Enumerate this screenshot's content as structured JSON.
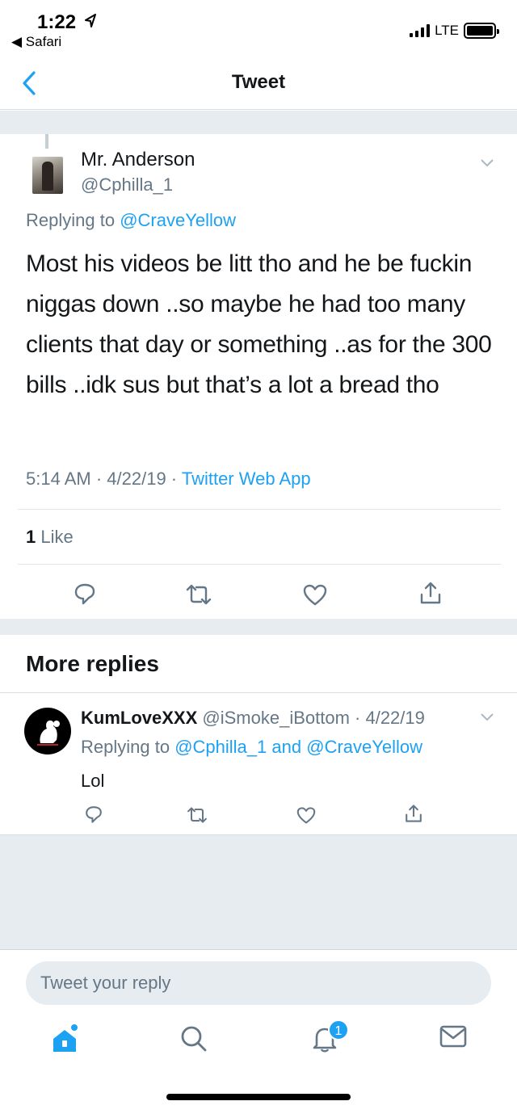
{
  "status_bar": {
    "time": "1:22",
    "back_app": "◀ Safari",
    "network": "LTE",
    "signal_bars": 4,
    "battery_level": 0.85
  },
  "nav": {
    "title": "Tweet",
    "back_icon": "chevron-left-icon"
  },
  "tweet": {
    "author_name": "Mr. Anderson",
    "author_handle": "@Cphilla_1",
    "replying_prefix": "Replying to",
    "replying_to": "@CraveYellow",
    "text": "Most his videos be litt tho and he be fuckin niggas down ..so maybe he had too many clients that day or something ..as for the 300 bills ..idk sus but that’s a lot a bread tho",
    "time": "5:14 AM",
    "date": "4/22/19",
    "source": "Twitter Web App",
    "like_count": "1",
    "like_label": "Like"
  },
  "more_replies": {
    "title": "More replies",
    "items": [
      {
        "name": "KumLoveXXX",
        "handle": "@iSmoke_iBottom",
        "date": "4/22/19",
        "replying_prefix": "Replying to",
        "replying_to_1": "@Cphilla_1",
        "replying_and": "and",
        "replying_to_2": "@CraveYellow",
        "text": "Lol"
      }
    ]
  },
  "composer": {
    "placeholder": "Tweet your reply"
  },
  "tabbar": {
    "notifications_badge": "1"
  },
  "colors": {
    "accent": "#1da1f2",
    "secondary_text": "#657786",
    "band": "#e6ecf0"
  }
}
